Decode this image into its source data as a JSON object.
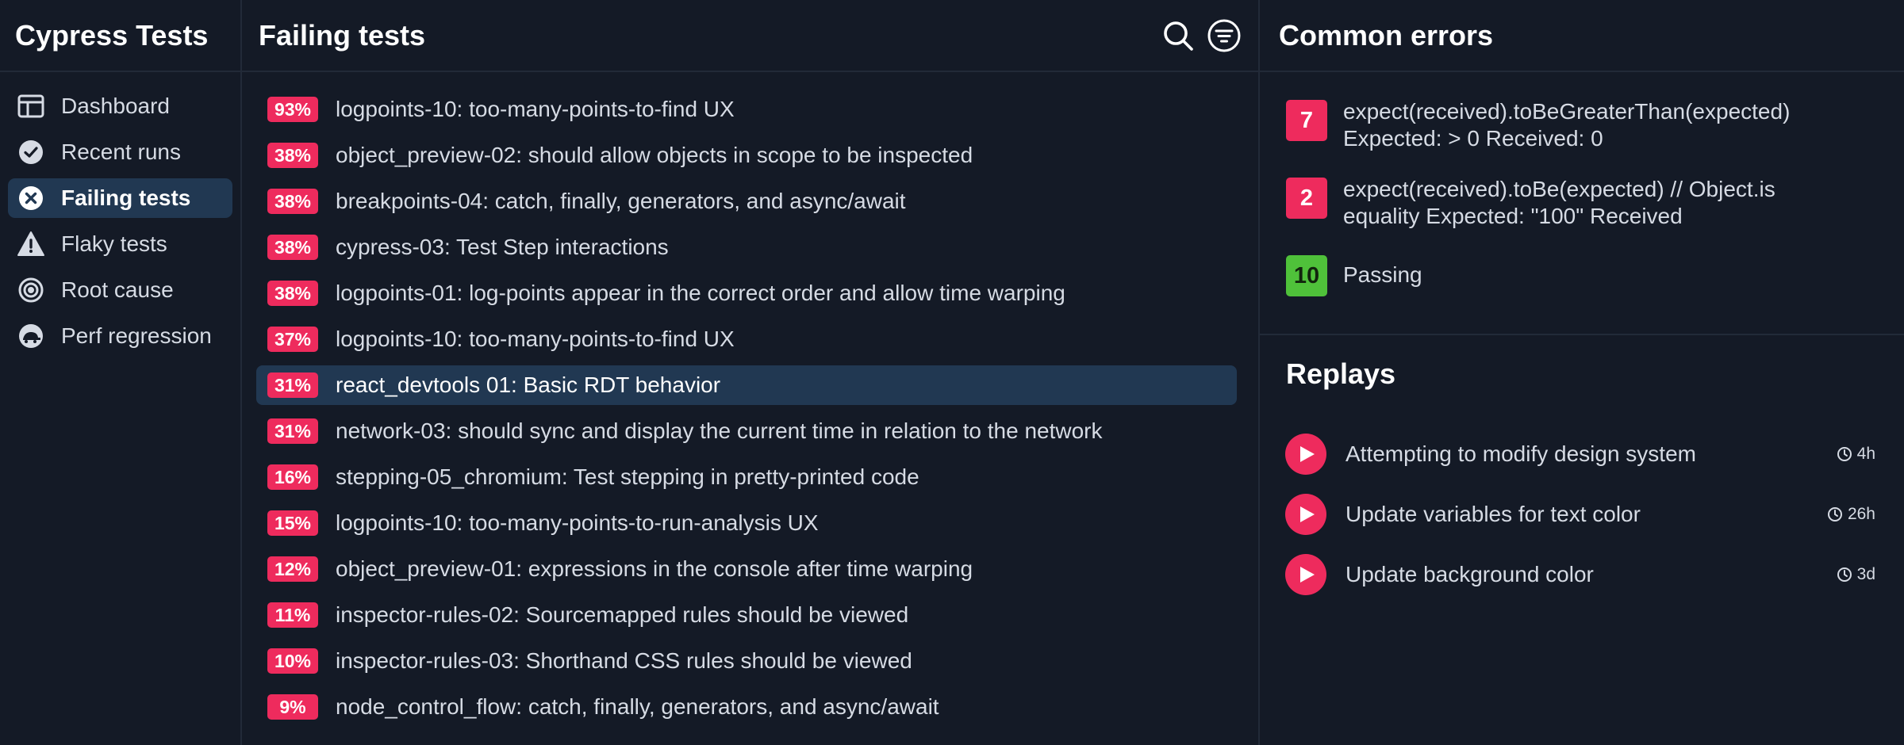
{
  "sidebar": {
    "title": "Cypress Tests",
    "items": [
      {
        "label": "Dashboard",
        "icon": "dashboard-icon",
        "active": false
      },
      {
        "label": "Recent runs",
        "icon": "check-circle-icon",
        "active": false
      },
      {
        "label": "Failing tests",
        "icon": "x-circle-icon",
        "active": true
      },
      {
        "label": "Flaky tests",
        "icon": "warning-icon",
        "active": false
      },
      {
        "label": "Root cause",
        "icon": "target-icon",
        "active": false
      },
      {
        "label": "Perf regression",
        "icon": "turtle-icon",
        "active": false
      }
    ]
  },
  "main": {
    "title": "Failing tests",
    "search_icon": "search-icon",
    "filter_icon": "filter-icon",
    "tests": [
      {
        "pct": "93%",
        "name": "logpoints-10: too-many-points-to-find UX"
      },
      {
        "pct": "38%",
        "name": "object_preview-02: should allow objects in scope to be inspected"
      },
      {
        "pct": "38%",
        "name": "breakpoints-04: catch, finally, generators, and async/await"
      },
      {
        "pct": "38%",
        "name": "cypress-03: Test Step interactions"
      },
      {
        "pct": "38%",
        "name": "logpoints-01: log-points appear in the correct order and allow time warping"
      },
      {
        "pct": "37%",
        "name": "logpoints-10: too-many-points-to-find UX"
      },
      {
        "pct": "31%",
        "name": "react_devtools 01: Basic RDT behavior",
        "selected": true
      },
      {
        "pct": "31%",
        "name": "network-03: should sync and display the current time in relation to the network"
      },
      {
        "pct": "16%",
        "name": "stepping-05_chromium: Test stepping in pretty-printed code"
      },
      {
        "pct": "15%",
        "name": "logpoints-10: too-many-points-to-run-analysis UX"
      },
      {
        "pct": "12%",
        "name": "object_preview-01: expressions in the console after time warping"
      },
      {
        "pct": "11%",
        "name": "inspector-rules-02: Sourcemapped rules should be viewed"
      },
      {
        "pct": "10%",
        "name": "inspector-rules-03: Shorthand CSS rules should be viewed"
      },
      {
        "pct": "9%",
        "name": "node_control_flow: catch, finally, generators, and async/await"
      }
    ]
  },
  "errors": {
    "title": "Common errors",
    "items": [
      {
        "count": "7",
        "line1": "expect(received).toBeGreaterThan(expected)",
        "line2": "Expected: > 0 Received: 0"
      },
      {
        "count": "2",
        "line1": "expect(received).toBe(expected) // Object.is",
        "line2": "equality Expected: \"100\" Received"
      }
    ],
    "passing": {
      "count": "10",
      "label": "Passing"
    }
  },
  "replays": {
    "title": "Replays",
    "items": [
      {
        "title": "Attempting to modify design system",
        "time": "4h"
      },
      {
        "title": "Update variables for text color",
        "time": "26h"
      },
      {
        "title": "Update background color",
        "time": "3d"
      }
    ]
  },
  "colors": {
    "background": "#141a26",
    "selected": "#213852",
    "accent": "#ee2b5d",
    "passing": "#4fc13a"
  }
}
